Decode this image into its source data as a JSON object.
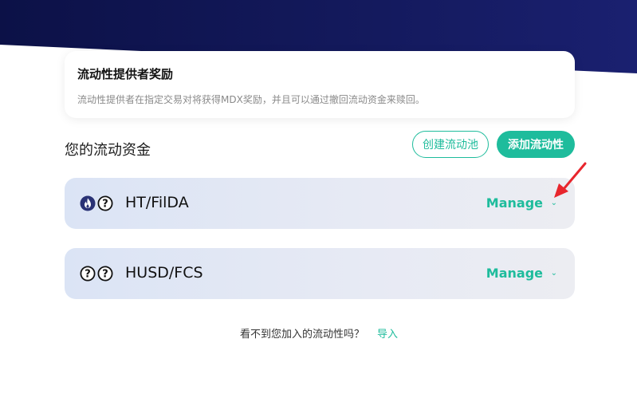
{
  "info": {
    "title": "流动性提供者奖励",
    "description": "流动性提供者在指定交易对将获得MDX奖励，并且可以通过撤回流动资金来赎回。"
  },
  "section_title": "您的流动资金",
  "buttons": {
    "create_pool": "创建流动池",
    "add_liquidity": "添加流动性"
  },
  "pairs": [
    {
      "name": "HT/FilDA",
      "manage": "Manage",
      "icons": [
        "ht-flame-icon",
        "unknown-token-icon"
      ]
    },
    {
      "name": "HUSD/FCS",
      "manage": "Manage",
      "icons": [
        "unknown-token-icon",
        "unknown-token-icon"
      ]
    }
  ],
  "footer": {
    "question": "看不到您加入的流动性吗？",
    "import_link": "导入"
  },
  "colors": {
    "accent": "#1ebc9c",
    "header": "#0c1147"
  }
}
